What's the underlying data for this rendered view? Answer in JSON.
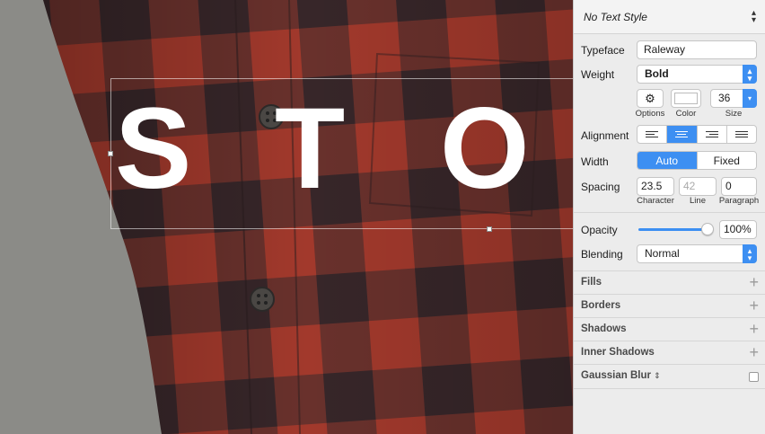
{
  "canvas": {
    "letters": [
      "S",
      "T",
      "O"
    ]
  },
  "inspector": {
    "text_style": "No Text Style",
    "typeface": {
      "label": "Typeface",
      "value": "Raleway"
    },
    "weight": {
      "label": "Weight",
      "value": "Bold"
    },
    "options_label": "Options",
    "color_label": "Color",
    "color_value": "#ffffff",
    "size_label": "Size",
    "size_value": "36",
    "alignment_label": "Alignment",
    "alignment_selected": "center",
    "width": {
      "label": "Width",
      "options": [
        "Auto",
        "Fixed"
      ],
      "selected": "Auto"
    },
    "spacing": {
      "label": "Spacing",
      "character": "23.5",
      "line": "42",
      "paragraph": "0",
      "character_label": "Character",
      "line_label": "Line",
      "paragraph_label": "Paragraph"
    },
    "opacity": {
      "label": "Opacity",
      "value": "100%",
      "level": 1.0
    },
    "blending": {
      "label": "Blending",
      "value": "Normal"
    },
    "sections": [
      "Fills",
      "Borders",
      "Shadows",
      "Inner Shadows"
    ],
    "gaussian_blur": "Gaussian Blur",
    "accent": "#3d8ff2"
  }
}
